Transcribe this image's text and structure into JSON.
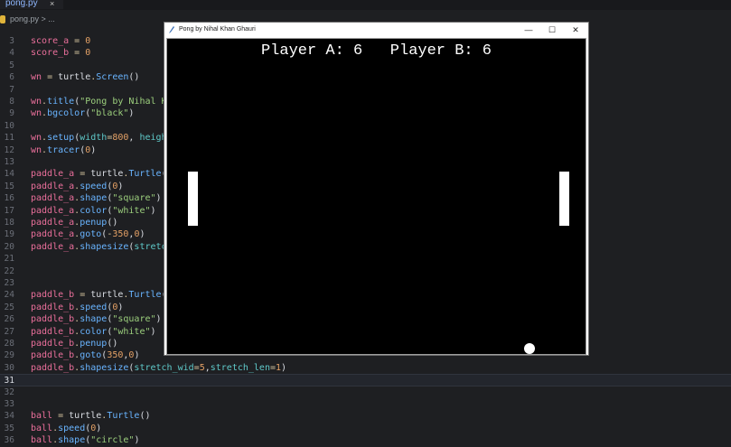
{
  "editor": {
    "tab_name": "pong.py",
    "tab_close": "×",
    "breadcrumb": "pong.py > ...",
    "lines": [
      {
        "num": "3",
        "spans": [
          [
            "v",
            "score_a"
          ],
          [
            "o",
            " = "
          ],
          [
            "n",
            "0"
          ]
        ]
      },
      {
        "num": "4",
        "spans": [
          [
            "v",
            "score_b"
          ],
          [
            "o",
            " = "
          ],
          [
            "n",
            "0"
          ]
        ]
      },
      {
        "num": "5",
        "spans": []
      },
      {
        "num": "6",
        "spans": [
          [
            "v",
            "wn"
          ],
          [
            "o",
            " = "
          ],
          [
            "p",
            "turtle"
          ],
          [
            "o",
            "."
          ],
          [
            "f",
            "Screen"
          ],
          [
            "p",
            "()"
          ]
        ]
      },
      {
        "num": "7",
        "spans": []
      },
      {
        "num": "8",
        "spans": [
          [
            "v",
            "wn"
          ],
          [
            "o",
            "."
          ],
          [
            "f",
            "title"
          ],
          [
            "p",
            "("
          ],
          [
            "s",
            "\"Pong by Nihal Kh"
          ]
        ]
      },
      {
        "num": "9",
        "spans": [
          [
            "v",
            "wn"
          ],
          [
            "o",
            "."
          ],
          [
            "f",
            "bgcolor"
          ],
          [
            "p",
            "("
          ],
          [
            "s",
            "\"black\""
          ],
          [
            "p",
            ")"
          ]
        ]
      },
      {
        "num": "10",
        "spans": []
      },
      {
        "num": "11",
        "spans": [
          [
            "v",
            "wn"
          ],
          [
            "o",
            "."
          ],
          [
            "f",
            "setup"
          ],
          [
            "p",
            "("
          ],
          [
            "c",
            "width"
          ],
          [
            "o",
            "="
          ],
          [
            "n",
            "800"
          ],
          [
            "p",
            ", "
          ],
          [
            "c",
            "height"
          ]
        ]
      },
      {
        "num": "12",
        "spans": [
          [
            "v",
            "wn"
          ],
          [
            "o",
            "."
          ],
          [
            "f",
            "tracer"
          ],
          [
            "p",
            "("
          ],
          [
            "n",
            "0"
          ],
          [
            "p",
            ")"
          ]
        ]
      },
      {
        "num": "13",
        "spans": []
      },
      {
        "num": "14",
        "spans": [
          [
            "v",
            "paddle_a"
          ],
          [
            "o",
            " = "
          ],
          [
            "p",
            "turtle"
          ],
          [
            "o",
            "."
          ],
          [
            "f",
            "Turtle"
          ],
          [
            "p",
            "()"
          ]
        ]
      },
      {
        "num": "15",
        "spans": [
          [
            "v",
            "paddle_a"
          ],
          [
            "o",
            "."
          ],
          [
            "f",
            "speed"
          ],
          [
            "p",
            "("
          ],
          [
            "n",
            "0"
          ],
          [
            "p",
            ")"
          ]
        ]
      },
      {
        "num": "16",
        "spans": [
          [
            "v",
            "paddle_a"
          ],
          [
            "o",
            "."
          ],
          [
            "f",
            "shape"
          ],
          [
            "p",
            "("
          ],
          [
            "s",
            "\"square\""
          ],
          [
            "p",
            ")"
          ]
        ]
      },
      {
        "num": "17",
        "spans": [
          [
            "v",
            "paddle_a"
          ],
          [
            "o",
            "."
          ],
          [
            "f",
            "color"
          ],
          [
            "p",
            "("
          ],
          [
            "s",
            "\"white\""
          ],
          [
            "p",
            ")"
          ]
        ]
      },
      {
        "num": "18",
        "spans": [
          [
            "v",
            "paddle_a"
          ],
          [
            "o",
            "."
          ],
          [
            "f",
            "penup"
          ],
          [
            "p",
            "()"
          ]
        ]
      },
      {
        "num": "19",
        "spans": [
          [
            "v",
            "paddle_a"
          ],
          [
            "o",
            "."
          ],
          [
            "f",
            "goto"
          ],
          [
            "p",
            "("
          ],
          [
            "o",
            "-"
          ],
          [
            "n",
            "350"
          ],
          [
            "p",
            ","
          ],
          [
            "n",
            "0"
          ],
          [
            "p",
            ")"
          ]
        ]
      },
      {
        "num": "20",
        "spans": [
          [
            "v",
            "paddle_a"
          ],
          [
            "o",
            "."
          ],
          [
            "f",
            "shapesize"
          ],
          [
            "p",
            "("
          ],
          [
            "c",
            "stretch"
          ]
        ]
      },
      {
        "num": "21",
        "spans": []
      },
      {
        "num": "22",
        "spans": []
      },
      {
        "num": "23",
        "spans": []
      },
      {
        "num": "24",
        "spans": [
          [
            "v",
            "paddle_b"
          ],
          [
            "o",
            " = "
          ],
          [
            "p",
            "turtle"
          ],
          [
            "o",
            "."
          ],
          [
            "f",
            "Turtle"
          ],
          [
            "p",
            "()"
          ]
        ]
      },
      {
        "num": "25",
        "spans": [
          [
            "v",
            "paddle_b"
          ],
          [
            "o",
            "."
          ],
          [
            "f",
            "speed"
          ],
          [
            "p",
            "("
          ],
          [
            "n",
            "0"
          ],
          [
            "p",
            ")"
          ]
        ]
      },
      {
        "num": "26",
        "spans": [
          [
            "v",
            "paddle_b"
          ],
          [
            "o",
            "."
          ],
          [
            "f",
            "shape"
          ],
          [
            "p",
            "("
          ],
          [
            "s",
            "\"square\""
          ],
          [
            "p",
            ")"
          ]
        ]
      },
      {
        "num": "27",
        "spans": [
          [
            "v",
            "paddle_b"
          ],
          [
            "o",
            "."
          ],
          [
            "f",
            "color"
          ],
          [
            "p",
            "("
          ],
          [
            "s",
            "\"white\""
          ],
          [
            "p",
            ")"
          ]
        ]
      },
      {
        "num": "28",
        "spans": [
          [
            "v",
            "paddle_b"
          ],
          [
            "o",
            "."
          ],
          [
            "f",
            "penup"
          ],
          [
            "p",
            "()"
          ]
        ]
      },
      {
        "num": "29",
        "spans": [
          [
            "v",
            "paddle_b"
          ],
          [
            "o",
            "."
          ],
          [
            "f",
            "goto"
          ],
          [
            "p",
            "("
          ],
          [
            "n",
            "350"
          ],
          [
            "p",
            ","
          ],
          [
            "n",
            "0"
          ],
          [
            "p",
            ")"
          ]
        ]
      },
      {
        "num": "30",
        "spans": [
          [
            "v",
            "paddle_b"
          ],
          [
            "o",
            "."
          ],
          [
            "f",
            "shapesize"
          ],
          [
            "p",
            "("
          ],
          [
            "c",
            "stretch_wid"
          ],
          [
            "o",
            "="
          ],
          [
            "n",
            "5"
          ],
          [
            "p",
            ","
          ],
          [
            "c",
            "stretch_len"
          ],
          [
            "o",
            "="
          ],
          [
            "n",
            "1"
          ],
          [
            "p",
            ")"
          ]
        ]
      },
      {
        "num": "31",
        "spans": [],
        "current": true
      },
      {
        "num": "32",
        "spans": []
      },
      {
        "num": "33",
        "spans": []
      },
      {
        "num": "34",
        "spans": [
          [
            "v",
            "ball"
          ],
          [
            "o",
            " = "
          ],
          [
            "p",
            "turtle"
          ],
          [
            "o",
            "."
          ],
          [
            "f",
            "Turtle"
          ],
          [
            "p",
            "()"
          ]
        ]
      },
      {
        "num": "35",
        "spans": [
          [
            "v",
            "ball"
          ],
          [
            "o",
            "."
          ],
          [
            "f",
            "speed"
          ],
          [
            "p",
            "("
          ],
          [
            "n",
            "0"
          ],
          [
            "p",
            ")"
          ]
        ]
      },
      {
        "num": "36",
        "spans": [
          [
            "v",
            "ball"
          ],
          [
            "o",
            "."
          ],
          [
            "f",
            "shape"
          ],
          [
            "p",
            "("
          ],
          [
            "s",
            "\"circle\""
          ],
          [
            "p",
            ")"
          ]
        ]
      }
    ]
  },
  "window": {
    "title": "Pong by Nihal Khan Ghauri",
    "minimize": "—",
    "maximize": "☐",
    "close": "✕"
  },
  "game": {
    "score_text": "Player A: 6   Player B: 6",
    "player_a_score": 6,
    "player_b_score": 6,
    "colors": {
      "background": "#000000",
      "foreground": "#ffffff"
    }
  }
}
